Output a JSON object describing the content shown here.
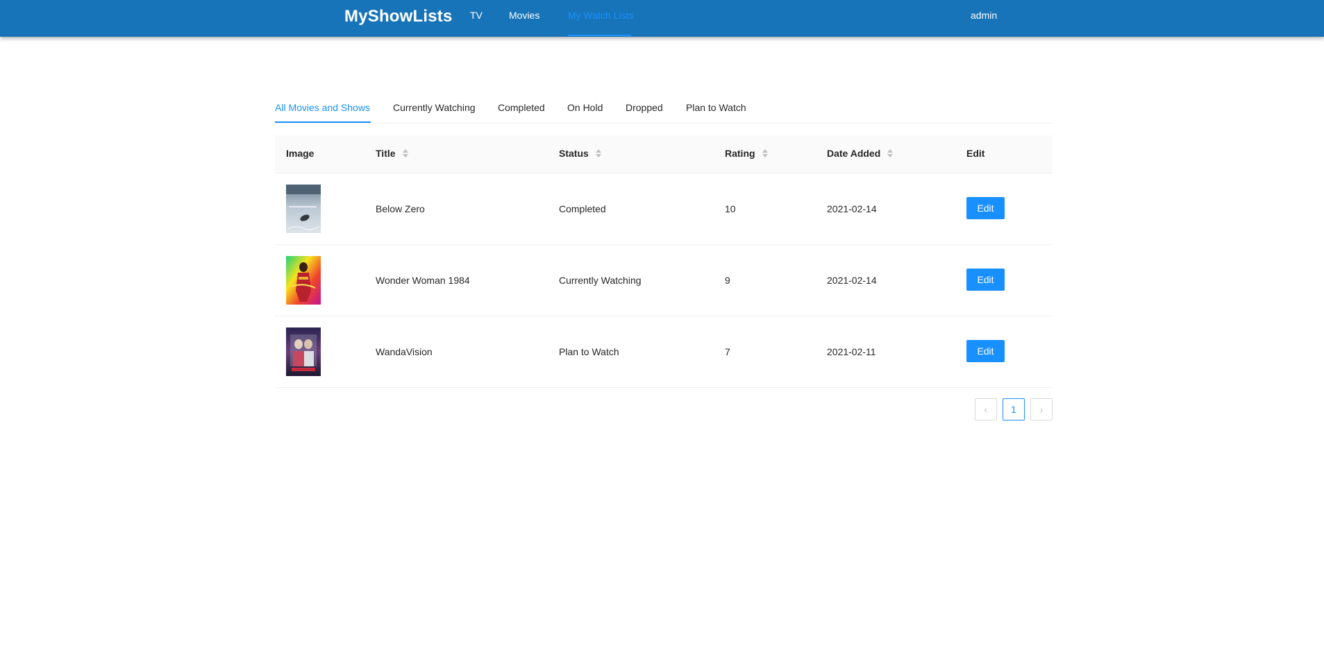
{
  "header": {
    "brand": "MyShowLists",
    "nav": [
      {
        "label": "TV",
        "active": false
      },
      {
        "label": "Movies",
        "active": false
      },
      {
        "label": "My Watch Lists",
        "active": true
      }
    ],
    "user": "admin"
  },
  "tabs": [
    {
      "label": "All Movies and Shows",
      "active": true
    },
    {
      "label": "Currently Watching",
      "active": false
    },
    {
      "label": "Completed",
      "active": false
    },
    {
      "label": "On Hold",
      "active": false
    },
    {
      "label": "Dropped",
      "active": false
    },
    {
      "label": "Plan to Watch",
      "active": false
    }
  ],
  "table": {
    "columns": [
      "Image",
      "Title",
      "Status",
      "Rating",
      "Date Added",
      "Edit"
    ],
    "rows": [
      {
        "title": "Below Zero",
        "status": "Completed",
        "rating": "10",
        "date_added": "2021-02-14",
        "edit_label": "Edit"
      },
      {
        "title": "Wonder Woman 1984",
        "status": "Currently Watching",
        "rating": "9",
        "date_added": "2021-02-14",
        "edit_label": "Edit"
      },
      {
        "title": "WandaVision",
        "status": "Plan to Watch",
        "rating": "7",
        "date_added": "2021-02-11",
        "edit_label": "Edit"
      }
    ]
  },
  "pagination": {
    "prev": "‹",
    "current_page": "1",
    "next": "›"
  },
  "colors": {
    "header_bg": "#1874b9",
    "accent": "#1890ff"
  },
  "icons": {
    "sorter": "sort-caret-icon",
    "prev": "chevron-left-icon",
    "next": "chevron-right-icon"
  }
}
